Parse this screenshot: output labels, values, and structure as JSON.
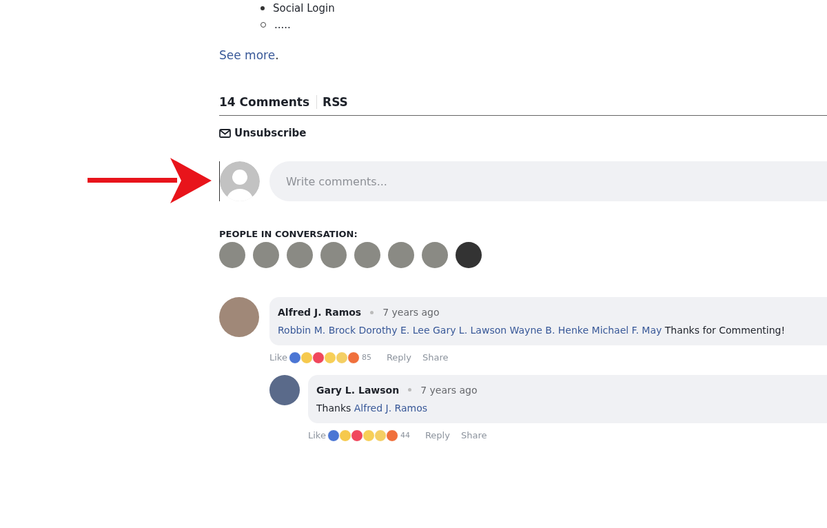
{
  "article_tail": {
    "bullets": [
      {
        "kind": "disc",
        "text": "Social Login"
      },
      {
        "kind": "circle",
        "text": "....."
      }
    ],
    "see_more": {
      "link": "See more",
      "after": "."
    }
  },
  "comments_header": {
    "count_label": "14 Comments",
    "rss": "RSS",
    "unsubscribe": "Unsubscribe"
  },
  "composer": {
    "placeholder": "Write comments...",
    "pointer_arrow": true
  },
  "people": {
    "title": "PEOPLE IN CONVERSATION:",
    "avatars": [
      {
        "kind": "photo"
      },
      {
        "kind": "photo"
      },
      {
        "kind": "photo"
      },
      {
        "kind": "photo"
      },
      {
        "kind": "photo"
      },
      {
        "kind": "photo"
      },
      {
        "kind": "photo"
      },
      {
        "kind": "photo"
      }
    ]
  },
  "comments": [
    {
      "author": "Alfred J. Ramos",
      "time": "7 years ago",
      "body": [
        {
          "kind": "link",
          "text": "Robbin M. Brock"
        },
        {
          "kind": "link",
          "text": "Dorothy E. Lee"
        },
        {
          "kind": "link",
          "text": "Gary L. Lawson"
        },
        {
          "kind": "link",
          "text": "Wayne B. Henke"
        },
        {
          "kind": "link",
          "text": "Michael F. May"
        },
        {
          "kind": "text",
          "text": "Thanks for Commenting!"
        }
      ],
      "like": "Like",
      "reaction_count": "85",
      "reply": "Reply",
      "share": "Share",
      "replies": [
        {
          "author": "Gary L. Lawson",
          "time": "7 years ago",
          "body": [
            {
              "kind": "text",
              "text": "Thanks"
            },
            {
              "kind": "link",
              "text": "Alfred J. Ramos"
            }
          ],
          "like": "Like",
          "reaction_count": "44",
          "reply": "Reply",
          "share": "Share"
        }
      ]
    }
  ]
}
